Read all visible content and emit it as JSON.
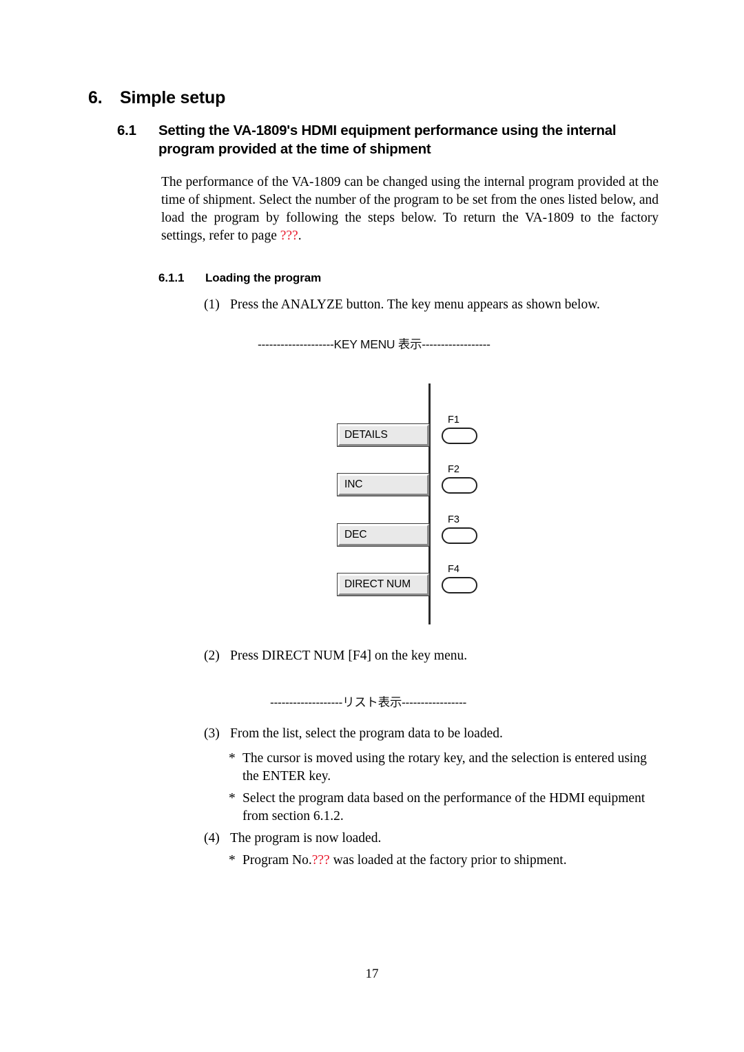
{
  "document": {
    "chapter": {
      "number": "6.",
      "title": "Simple setup"
    },
    "section": {
      "number": "6.1",
      "title": "Setting the VA-1809's HDMI equipment performance using the internal program provided at the time of shipment"
    },
    "intro_paragraph": {
      "text_before_ref": "The performance of the VA-1809 can be changed using the internal program provided at the time of shipment.   Select the number of the program to be set from the ones listed below, and load the program by following the steps below.   To return the VA-1809 to the factory settings, refer to page ",
      "reference": "???",
      "text_after_ref": "."
    },
    "subsection": {
      "number": "6.1.1",
      "title": "Loading the program"
    },
    "steps": [
      {
        "label": "(1)",
        "text": "Press the ANALYZE button.    The key menu appears as shown below."
      },
      {
        "label": "(2)",
        "text": "Press DIRECT NUM [F4] on the key menu."
      },
      {
        "label": "(3)",
        "text": "From the list, select the program data to be loaded."
      },
      {
        "label": "(4)",
        "text": "The program is now loaded."
      }
    ],
    "bullets": [
      {
        "marker": "*",
        "text": "The cursor is moved using the rotary key, and the selection is entered using the ENTER key."
      },
      {
        "marker": "*",
        "text": "Select the program data based on the performance of the HDMI equipment from section 6.1.2."
      },
      {
        "marker": "*",
        "text_before_ref": "Program No.",
        "reference": "???",
        "text_after_ref": " was loaded at the factory prior to shipment."
      }
    ],
    "figure_captions": {
      "key_menu": "--------------------KEY MENU 表示------------------",
      "list": "-------------------リスト表示-----------------"
    },
    "key_menu_figure": {
      "softkeys": [
        {
          "label": "DETAILS",
          "fkey": "F1"
        },
        {
          "label": "INC",
          "fkey": "F2"
        },
        {
          "label": "DEC",
          "fkey": "F3"
        },
        {
          "label": "DIRECT NUM",
          "fkey": "F4"
        }
      ]
    },
    "page_number": "17",
    "colors": {
      "reference_red": "#e8192c",
      "softkey_face": "#e9e9e9",
      "softkey_shadow": "#8a8a8a",
      "line_black": "#2b2b2b"
    }
  }
}
